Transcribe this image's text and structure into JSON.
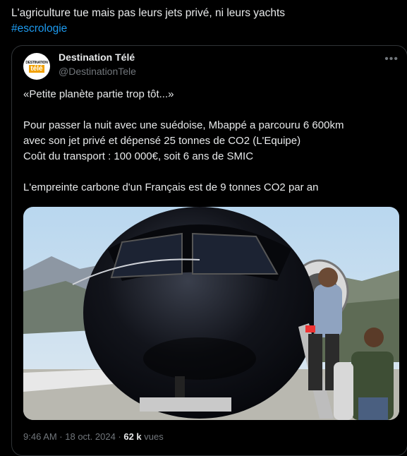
{
  "post": {
    "text": "L'agriculture tue mais pas leurs jets privé, ni leurs yachts",
    "hashtag": "#escrologie"
  },
  "quoted": {
    "author_name": "Destination Télé",
    "author_handle": "@DestinationTele",
    "avatar_text_top": "DESTINATION",
    "avatar_text_bottom": "télé",
    "more_icon": "more-horizontal-icon",
    "lines": [
      "«Petite planète partie trop tôt...»",
      "",
      "Pour passer la nuit avec une suédoise, Mbappé a parcouru 6 600km",
      "avec son jet privé et dépensé 25 tonnes de CO2 (L'Equipe)",
      "Coût du transport : 100 000€, soit 6 ans de SMIC",
      "",
      "L'empreinte carbone d'un Français est de 9 tonnes CO2 par an"
    ],
    "timestamp": "9:46 AM · 18 oct. 2024 · ",
    "views_count": "62 k",
    "views_label": " vues"
  },
  "colors": {
    "background": "#000000",
    "text": "#e7e9ea",
    "muted": "#71767b",
    "link": "#1d9bf0",
    "border": "#2f3336"
  }
}
